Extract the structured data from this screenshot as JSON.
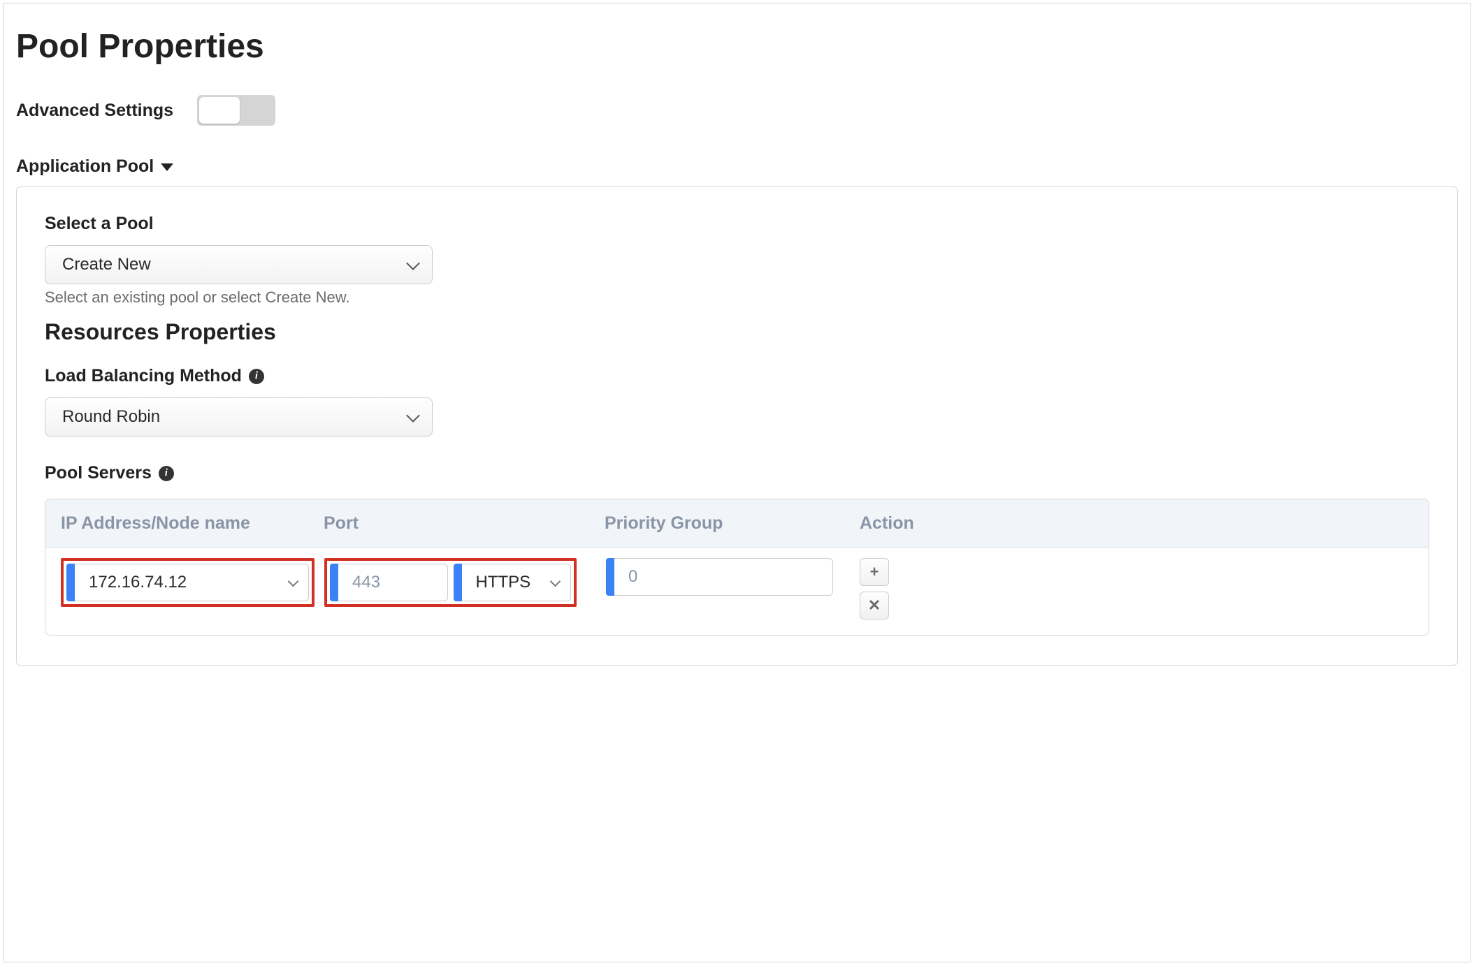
{
  "page_title": "Pool Properties",
  "advanced": {
    "label": "Advanced Settings",
    "enabled": false
  },
  "section": {
    "title": "Application Pool",
    "select_pool": {
      "label": "Select a Pool",
      "value": "Create New",
      "help": "Select an existing pool or select Create New."
    },
    "resources_heading": "Resources Properties",
    "lb_method": {
      "label": "Load Balancing Method",
      "value": "Round Robin"
    },
    "pool_servers": {
      "label": "Pool Servers",
      "columns": {
        "ip": "IP Address/Node name",
        "port": "Port",
        "priority": "Priority Group",
        "action": "Action"
      },
      "rows": [
        {
          "ip": "172.16.74.12",
          "port_number": "443",
          "port_name": "HTTPS",
          "priority": "0"
        }
      ],
      "actions": {
        "add": "+",
        "remove": "✕"
      }
    }
  }
}
